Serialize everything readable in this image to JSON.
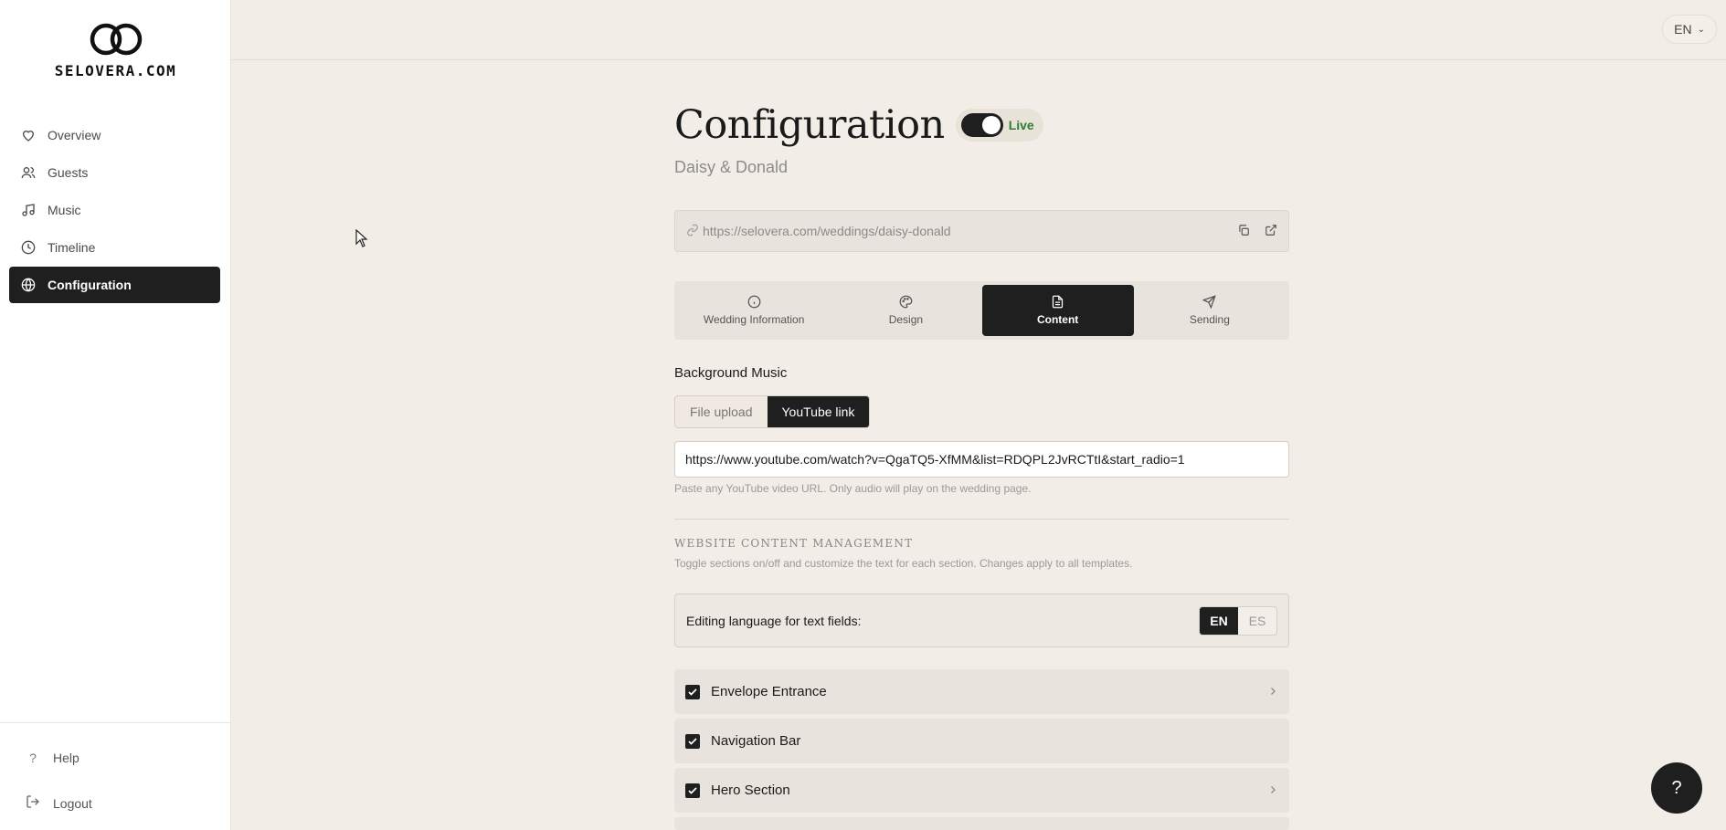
{
  "brand": {
    "name": "SELOVERA.COM"
  },
  "sidebar": {
    "items": [
      {
        "label": "Overview",
        "icon": "heart-icon"
      },
      {
        "label": "Guests",
        "icon": "users-icon"
      },
      {
        "label": "Music",
        "icon": "music-icon"
      },
      {
        "label": "Timeline",
        "icon": "clock-icon"
      },
      {
        "label": "Configuration",
        "icon": "globe-icon",
        "active": true
      }
    ],
    "help_label": "Help",
    "logout_label": "Logout"
  },
  "topbar": {
    "language": "EN"
  },
  "page": {
    "title": "Configuration",
    "live_label": "Live",
    "couple": "Daisy & Donald",
    "url": "https://selovera.com/weddings/daisy-donald"
  },
  "tabs": [
    {
      "label": "Wedding Information",
      "icon": "info-icon"
    },
    {
      "label": "Design",
      "icon": "palette-icon"
    },
    {
      "label": "Content",
      "icon": "document-icon",
      "active": true
    },
    {
      "label": "Sending",
      "icon": "send-icon"
    }
  ],
  "background_music": {
    "label": "Background Music",
    "options": [
      "File upload",
      "YouTube link"
    ],
    "selected": "YouTube link",
    "youtube_url": "https://www.youtube.com/watch?v=QgaTQ5-XfMM&list=RDQPL2JvRCTtI&start_radio=1",
    "help": "Paste any YouTube video URL. Only audio will play on the wedding page."
  },
  "content_management": {
    "title": "Website Content Management",
    "description": "Toggle sections on/off and customize the text for each section. Changes apply to all templates.",
    "editing_language_label": "Editing language for text fields:",
    "languages": [
      "EN",
      "ES"
    ],
    "selected_language": "EN",
    "sections": [
      {
        "label": "Envelope Entrance",
        "checked": true,
        "expandable": true
      },
      {
        "label": "Navigation Bar",
        "checked": true,
        "expandable": false
      },
      {
        "label": "Hero Section",
        "checked": true,
        "expandable": true
      }
    ]
  },
  "fab": {
    "label": "?"
  },
  "colors": {
    "dark": "#1f1f1f",
    "background": "#f2ede6",
    "live": "#2e7d32"
  }
}
